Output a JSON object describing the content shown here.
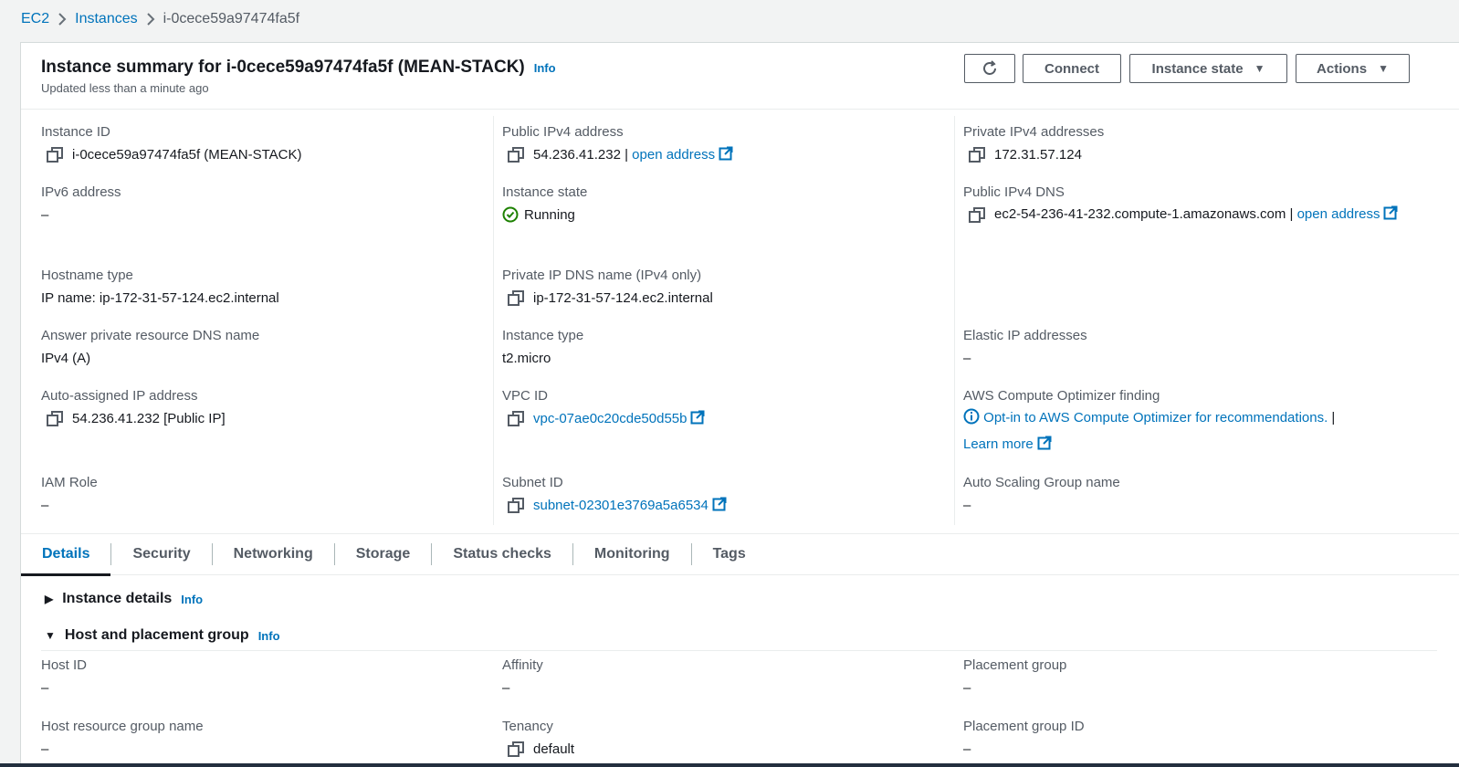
{
  "breadcrumb": {
    "items": [
      "EC2",
      "Instances"
    ],
    "current": "i-0cece59a97474fa5f"
  },
  "summary": {
    "title": "Instance summary for i-0cece59a97474fa5f (MEAN-STACK)",
    "info": "Info",
    "updated": "Updated less than a minute ago"
  },
  "toolbar": {
    "connect": "Connect",
    "instance_state": "Instance state",
    "actions": "Actions"
  },
  "fields": {
    "instance_id": {
      "label": "Instance ID",
      "value": "i-0cece59a97474fa5f (MEAN-STACK)"
    },
    "public_ipv4": {
      "label": "Public IPv4 address",
      "value": "54.236.41.232 | ",
      "link": "open address"
    },
    "private_ipv4": {
      "label": "Private IPv4 addresses",
      "value": "172.31.57.124"
    },
    "ipv6": {
      "label": "IPv6 address",
      "value": "–"
    },
    "instance_state": {
      "label": "Instance state",
      "value": "Running"
    },
    "public_dns": {
      "label": "Public IPv4 DNS",
      "value": "ec2-54-236-41-232.compute-1.amazonaws.com | ",
      "link": "open address"
    },
    "hostname_type": {
      "label": "Hostname type",
      "value": "IP name: ip-172-31-57-124.ec2.internal"
    },
    "private_dns": {
      "label": "Private IP DNS name (IPv4 only)",
      "value": "ip-172-31-57-124.ec2.internal"
    },
    "answer_dns": {
      "label": "Answer private resource DNS name",
      "value": "IPv4 (A)"
    },
    "instance_type": {
      "label": "Instance type",
      "value": "t2.micro"
    },
    "elastic_ip": {
      "label": "Elastic IP addresses",
      "value": "–"
    },
    "auto_ip": {
      "label": "Auto-assigned IP address",
      "value": "54.236.41.232 [Public IP]"
    },
    "vpc_id": {
      "label": "VPC ID",
      "value": "vpc-07ae0c20cde50d55b"
    },
    "optimizer": {
      "label": "AWS Compute Optimizer finding",
      "value": "Opt-in to AWS Compute Optimizer for recommendations.",
      "sep": " |",
      "learn": "Learn more"
    },
    "iam_role": {
      "label": "IAM Role",
      "value": "–"
    },
    "subnet_id": {
      "label": "Subnet ID",
      "value": "subnet-02301e3769a5a6534"
    },
    "asg_name": {
      "label": "Auto Scaling Group name",
      "value": "–"
    }
  },
  "tabs": [
    "Details",
    "Security",
    "Networking",
    "Storage",
    "Status checks",
    "Monitoring",
    "Tags"
  ],
  "sections": {
    "instance_details": {
      "title": "Instance details",
      "info": "Info"
    },
    "host_placement": {
      "title": "Host and placement group",
      "info": "Info"
    }
  },
  "host_fields": {
    "host_id": {
      "label": "Host ID",
      "value": "–"
    },
    "affinity": {
      "label": "Affinity",
      "value": "–"
    },
    "placement_group": {
      "label": "Placement group",
      "value": "–"
    },
    "host_resource_group": {
      "label": "Host resource group name",
      "value": "–"
    },
    "tenancy": {
      "label": "Tenancy",
      "value": "default"
    },
    "placement_group_id": {
      "label": "Placement group ID",
      "value": "–"
    }
  }
}
